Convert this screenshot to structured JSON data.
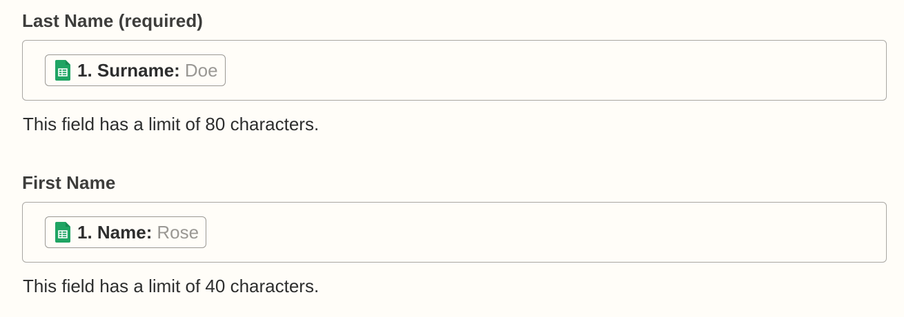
{
  "fields": [
    {
      "label": "Last Name (required)",
      "token": {
        "icon": "google-sheets-icon",
        "key": "1. Surname:",
        "value": "Doe"
      },
      "help": "This field has a limit of 80 characters."
    },
    {
      "label": "First Name",
      "token": {
        "icon": "google-sheets-icon",
        "key": "1. Name:",
        "value": "Rose"
      },
      "help": "This field has a limit of 40 characters."
    }
  ],
  "colors": {
    "background": "#fffdf8",
    "text": "#2d2e2e",
    "muted": "#9a9894",
    "border": "#a8a6a2",
    "sheets_green": "#1fa463",
    "sheets_dark": "#168a52"
  }
}
